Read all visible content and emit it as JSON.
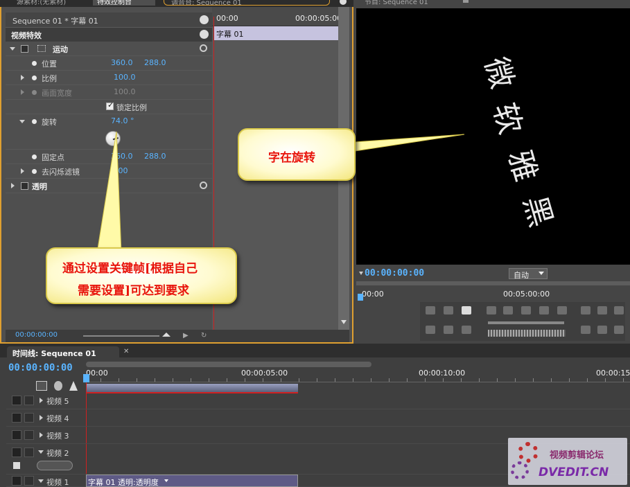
{
  "tabs": {
    "source": "源素材:(无素材)",
    "effect_controls": "特效控制台",
    "mixer": "调音台: Sequence 01",
    "program": "节目: Sequence 01"
  },
  "effect_controls": {
    "clip_path": "Sequence 01 * 字幕 01",
    "section_title": "视频特效",
    "timeline_start": "00:00",
    "timeline_end": "00:00:05:00",
    "clip_name": "字幕 01",
    "motion": "运动",
    "position_label": "位置",
    "position_x": "360.0",
    "position_y": "288.0",
    "scale_label": "比例",
    "scale_value": "100.0",
    "scale_width_label": "画面宽度",
    "scale_width_value": "100.0",
    "uniform_scale": "锁定比例",
    "rotation_label": "旋转",
    "rotation_value": "74.0 °",
    "anchor_label": "固定点",
    "anchor_x": "360.0",
    "anchor_y": "288.0",
    "antiflicker_label": "去闪烁滤镜",
    "antiflicker_value": "0.00",
    "opacity": "透明",
    "timecode": "00:00:00:00"
  },
  "program": {
    "timecode": "00:00:00:00",
    "zoom_select": "自动",
    "ruler_start": "00:00",
    "ruler_mid": "00:05:00:00"
  },
  "timeline": {
    "tab_label": "时间线: Sequence 01",
    "timecode": "00:00:00:00",
    "ruler": [
      "00:00",
      "00:00:05:00",
      "00:00:10:00",
      "00:00:15:"
    ],
    "tracks": [
      "视频 5",
      "视频 4",
      "视频 3",
      "视频 2",
      "视频 1"
    ],
    "clip_label": "字幕 01  透明:透明度"
  },
  "callouts": {
    "rotating_text": "字在旋转",
    "keyframe_line1": "通过设置关键帧[根据自己",
    "keyframe_line2": "需要设置]可达到要求"
  },
  "watermark": {
    "line1": "视频剪辑论坛",
    "line2": "DVEDIT.CN"
  },
  "colors": {
    "accent_orange": "#e0a030",
    "timecode_blue": "#5ab4ff",
    "playhead_red": "#d02020",
    "callout_text": "#e8140c"
  }
}
